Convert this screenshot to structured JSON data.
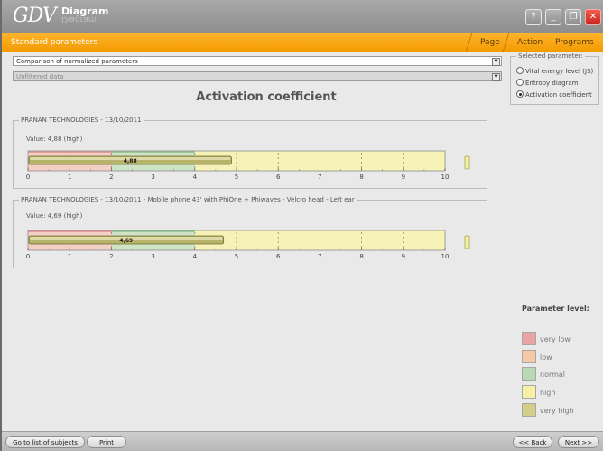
{
  "app": {
    "logo": "GDV",
    "logo_subtitle": "Diagram",
    "menu_title": "Standard parameters",
    "menu": [
      "Page",
      "Action",
      "Programs"
    ],
    "window_buttons": [
      {
        "icon": "help-icon",
        "glyph": "?"
      },
      {
        "icon": "minimize-icon",
        "glyph": "_"
      },
      {
        "icon": "restore-icon",
        "glyph": "❐"
      },
      {
        "icon": "close-icon",
        "glyph": "✕"
      }
    ]
  },
  "filters": {
    "mode_select": "Comparison of normalized parameters",
    "data_select": "Unfiltered data"
  },
  "main_title": "Activation coefficient",
  "selected_parameter": {
    "legend": "Selected parameter:",
    "options": [
      {
        "label": "Vital energy level (JS)",
        "selected": false
      },
      {
        "label": "Entropy diagram",
        "selected": false
      },
      {
        "label": "Activation coefficient",
        "selected": true
      }
    ]
  },
  "measurements": [
    {
      "title": "PRANAN TECHNOLOGIES - 13/10/2011",
      "value_text": "Value: 4,88 (high)",
      "value": 4.88,
      "bar_label": "4,88"
    },
    {
      "title": "PRANAN TECHNOLOGIES - 13/10/2011 - Mobile phone 43' with PhiOne + Phiwaves - Velcro head - Left ear",
      "value_text": "Value: 4,69 (high)",
      "value": 4.69,
      "bar_label": "4,69"
    }
  ],
  "scale": {
    "min": 0,
    "max": 10,
    "ticks": [
      "0",
      "1",
      "2",
      "3",
      "4",
      "5",
      "6",
      "7",
      "8",
      "9",
      "10"
    ],
    "zones": [
      {
        "level": "very low",
        "from": 0,
        "to": 2,
        "color": "#f3cfc6"
      },
      {
        "level": "normal",
        "from": 2,
        "to": 4,
        "color": "#cfe3c6"
      },
      {
        "level": "high",
        "from": 4,
        "to": 10,
        "color": "#f7f3b8"
      }
    ],
    "top_band": [
      {
        "from": 0,
        "to": 2,
        "color": "#e59a9a"
      },
      {
        "from": 2,
        "to": 4,
        "color": "#9cc99a"
      }
    ]
  },
  "parameter_levels": {
    "title": "Parameter level:",
    "items": [
      {
        "label": "very low",
        "color": "#e9a3a3"
      },
      {
        "label": "low",
        "color": "#f5c9a8"
      },
      {
        "label": "normal",
        "color": "#b9d8b4"
      },
      {
        "label": "high",
        "color": "#f7f1a8"
      },
      {
        "label": "very high",
        "color": "#d2cf88"
      }
    ]
  },
  "bottom": {
    "list_button": "Go to list of subjects",
    "print_button": "Print",
    "back_button": "<< Back",
    "next_button": "Next >>"
  }
}
